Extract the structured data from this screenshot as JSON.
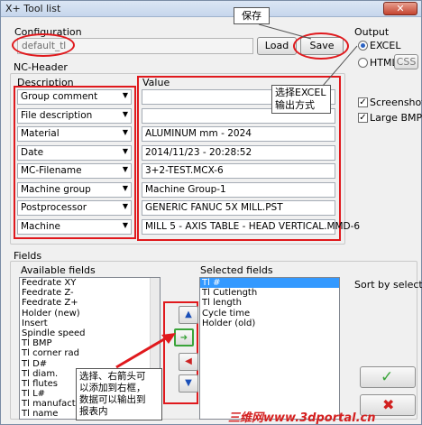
{
  "window": {
    "title": "X+ Tool list",
    "close": "✕"
  },
  "configuration": {
    "label": "Configuration",
    "value": "default_tl",
    "load_label": "Load",
    "save_label": "Save"
  },
  "output": {
    "label": "Output",
    "options": [
      "EXCEL",
      "HTML"
    ],
    "selected": "EXCEL",
    "css_label": "CSS",
    "screenshot_label": "Screenshot",
    "large_bmp_label": "Large BMP"
  },
  "nc_header": {
    "label": "NC-Header",
    "description_label": "Description",
    "value_label": "Value",
    "rows": [
      {
        "description": "Group comment",
        "value": ""
      },
      {
        "description": "File description",
        "value": ""
      },
      {
        "description": "Material",
        "value": "ALUMINUM mm - 2024"
      },
      {
        "description": "Date",
        "value": "2014/11/23 - 20:28:52"
      },
      {
        "description": "MC-Filename",
        "value": "3+2-TEST.MCX-6"
      },
      {
        "description": "Machine group",
        "value": "Machine Group-1"
      },
      {
        "description": "Postprocessor",
        "value": "GENERIC FANUC 5X MILL.PST"
      },
      {
        "description": "Machine",
        "value": "MILL 5 - AXIS TABLE - HEAD VERTICAL.MMD-6"
      }
    ]
  },
  "fields": {
    "label": "Fields",
    "available_label": "Available fields",
    "available": [
      "Feedrate XY",
      "Feedrate Z-",
      "Feedrate Z+",
      "Holder (new)",
      "Insert",
      "Spindle speed",
      "Tl BMP",
      "Tl corner rad",
      "Tl D#",
      "Tl diam.",
      "Tl flutes",
      "Tl L#",
      "Tl manufactor",
      "Tl name"
    ],
    "selected_label": "Selected fields",
    "selected": [
      "Tl #",
      "Tl Cutlength",
      "Tl length",
      "Cycle time",
      "Holder (old)"
    ],
    "sort_label": "Sort by selection"
  },
  "annotations": {
    "save": "保存",
    "excel": "选择EXCEL\n输出方式",
    "arrows": "选择、右箭头可\n以添加到右框，\n数据可以输出到\n报表内"
  },
  "watermark": "三维网www.3dportal.cn",
  "colors": {
    "accent": "#e0191d",
    "selection": "#3399ff",
    "ok": "#3aa43a",
    "cancel": "#d1201f"
  }
}
